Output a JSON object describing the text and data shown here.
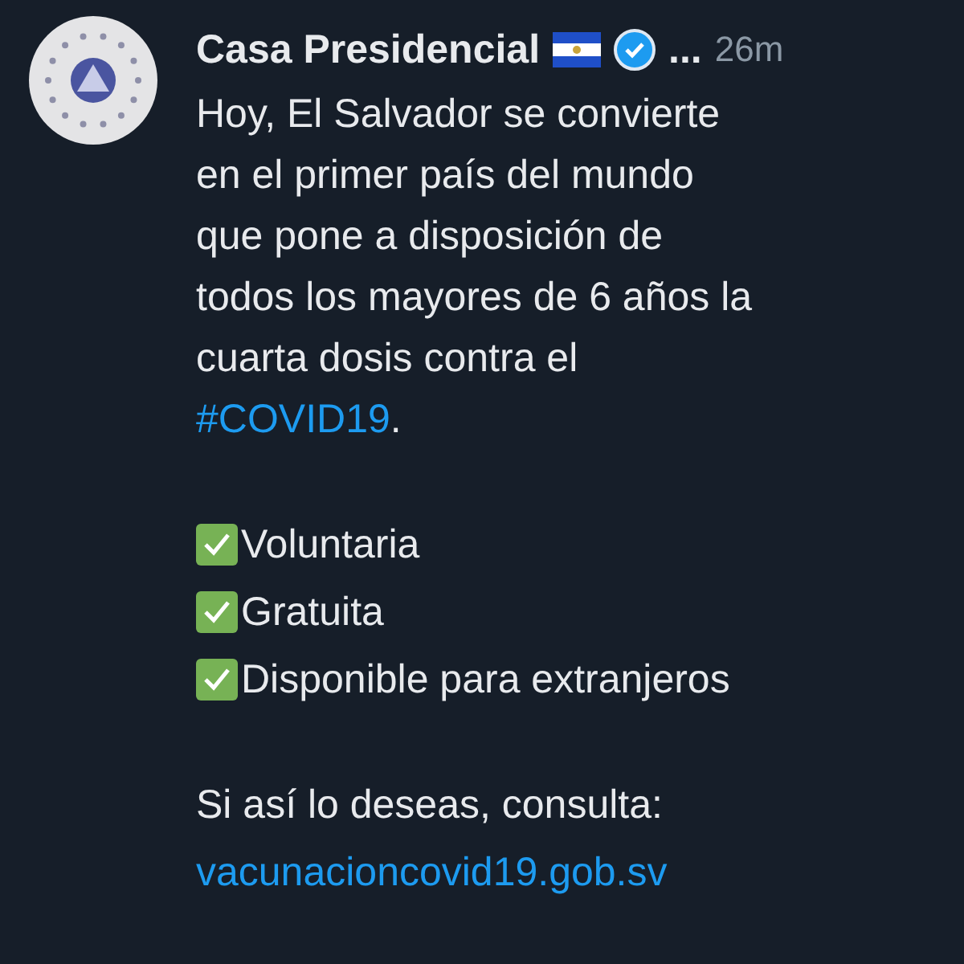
{
  "author": {
    "name": "Casa Presidencial",
    "more": "...",
    "time": "26m"
  },
  "paragraph": {
    "lines": [
      "Hoy, El Salvador se convierte",
      "en el primer país del mundo",
      "que pone a disposición de",
      "todos los mayores de 6 años la",
      "cuarta dosis contra el"
    ],
    "hashtag": "#COVID19",
    "after": "."
  },
  "checklist": [
    {
      "label": "Voluntaria"
    },
    {
      "label": "Gratuita"
    },
    {
      "label": "Disponible para extranjeros"
    }
  ],
  "closing": {
    "text": "Si así lo deseas, consulta:",
    "link": "vacunacioncovid19.gob.sv"
  }
}
